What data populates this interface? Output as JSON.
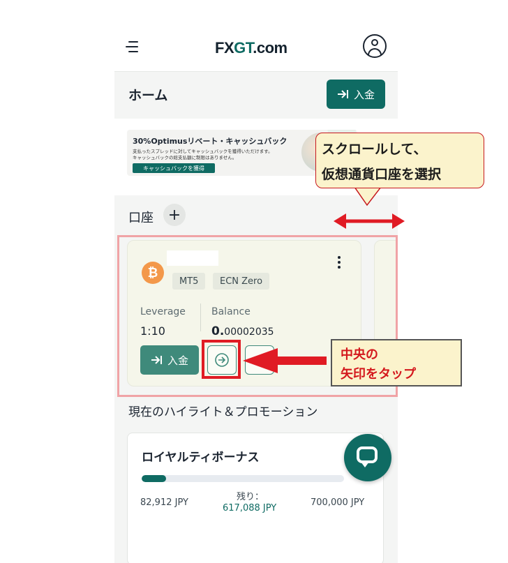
{
  "header": {
    "logo_main": "FX",
    "logo_accent": "GT",
    "logo_suffix": ".com"
  },
  "page": {
    "title": "ホーム",
    "deposit_button": "入金"
  },
  "banner": {
    "title": "30%Optimusリベート・キャッシュバック",
    "line1": "支払ったスプレッドに対してキャッシュバックを獲得いただけます。",
    "line2": "キャッシュバックの総支払額に制限はありません。",
    "button": "キャッシュバックを獲得"
  },
  "accounts": {
    "label": "口座",
    "add_symbol": "+",
    "card": {
      "currency_symbol": "₿",
      "platform": "MT5",
      "account_type": "ECN Zero",
      "leverage_label": "Leverage",
      "leverage_value": "1:10",
      "balance_label": "Balance",
      "balance_int": "0.",
      "balance_dec": "00002035",
      "deposit_button": "入金"
    }
  },
  "promotions": {
    "heading": "現在のハイライト＆プロモーション",
    "card": {
      "title": "ロイヤルティボーナス",
      "progress_fraction": 0.12,
      "current": "82,912 JPY",
      "remaining_label": "残り：",
      "remaining_value": "617,088 JPY",
      "target": "700,000 JPY"
    }
  },
  "annotations": {
    "callout_scroll_line1": "スクロールして、",
    "callout_scroll_line2": "仮想通貨口座を選択",
    "callout_tap_line1": "中央の",
    "callout_tap_line2": "矢印をタップ"
  },
  "colors": {
    "brand": "#0f6b63",
    "annotation_red": "#e01b24"
  }
}
